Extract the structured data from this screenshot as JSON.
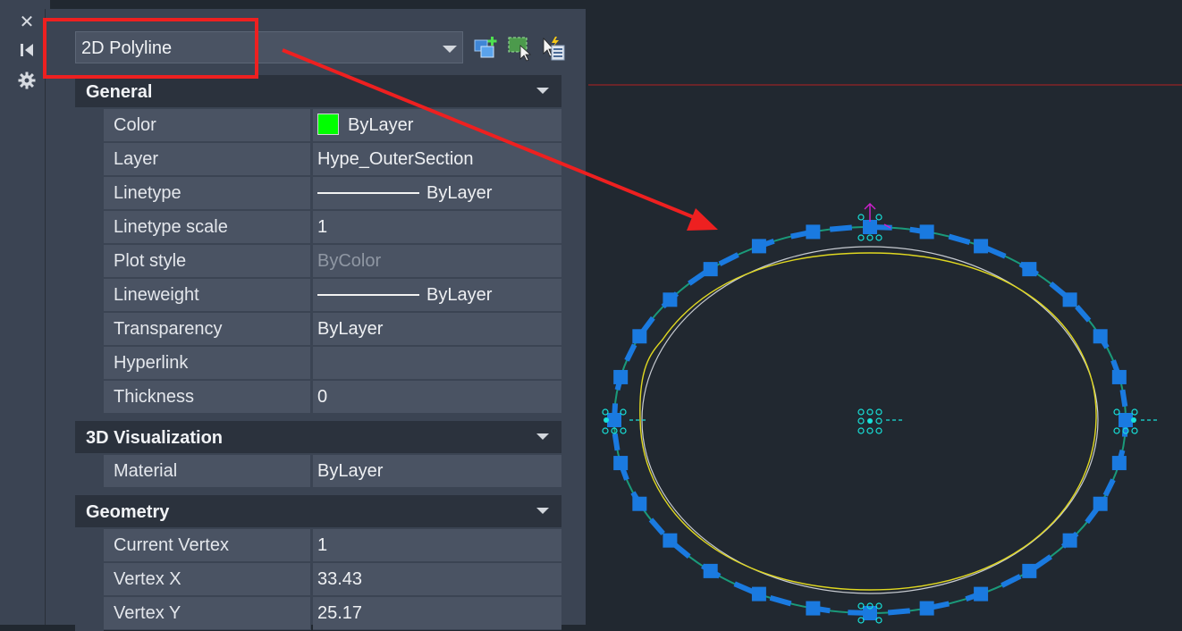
{
  "side_strip": {
    "close_icon": "close-icon",
    "dock_icon": "dock-icon",
    "settings_icon": "gear-icon"
  },
  "selector": {
    "value": "2D Polyline"
  },
  "toolbar": {
    "icons": [
      "add-to-selection-icon",
      "quick-select-icon",
      "select-objects-icon"
    ]
  },
  "sections": {
    "general": {
      "title": "General",
      "rows": [
        {
          "label": "Color",
          "value": "ByLayer",
          "swatch": "#00ff00"
        },
        {
          "label": "Layer",
          "value": "Hype_OuterSection"
        },
        {
          "label": "Linetype",
          "value": "ByLayer"
        },
        {
          "label": "Linetype scale",
          "value": "1"
        },
        {
          "label": "Plot style",
          "value": "ByColor"
        },
        {
          "label": "Lineweight",
          "value": "ByLayer"
        },
        {
          "label": "Transparency",
          "value": "ByLayer"
        },
        {
          "label": "Hyperlink",
          "value": ""
        },
        {
          "label": "Thickness",
          "value": "0"
        }
      ]
    },
    "visualization": {
      "title": "3D Visualization",
      "rows": [
        {
          "label": "Material",
          "value": "ByLayer"
        }
      ]
    },
    "geometry": {
      "title": "Geometry",
      "rows": [
        {
          "label": "Current Vertex",
          "value": "1"
        },
        {
          "label": "Vertex X",
          "value": "33.43"
        },
        {
          "label": "Vertex Y",
          "value": "25.17"
        }
      ]
    }
  },
  "colors": {
    "annotation_red": "#ee2020",
    "grip_blue": "#1a7ae0",
    "selected_polyline": "#1a7ae0",
    "inner_curve": "#e0d820",
    "middle_curve": "#c8ccd2",
    "osnap_cyan": "#18e0d8",
    "gizmo_magenta": "#d020d0"
  }
}
